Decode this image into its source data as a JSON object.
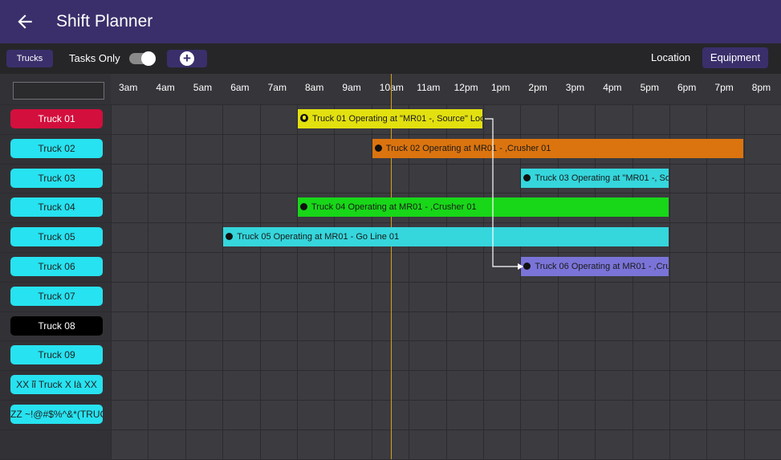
{
  "header": {
    "title": "Shift Planner",
    "back_icon": "arrow-left-icon",
    "bg": "#3a2f6b"
  },
  "toolbar": {
    "trucks_chip": "Trucks",
    "tasks_only_label": "Tasks Only",
    "tasks_only_on": false,
    "add_icon": "plus-circle-icon",
    "location_label": "Location",
    "equipment_label": "Equipment"
  },
  "search": {
    "value": "",
    "placeholder": ""
  },
  "timeline": {
    "hours": [
      "3am",
      "4am",
      "5am",
      "6am",
      "7am",
      "8am",
      "9am",
      "10am",
      "11am",
      "12pm",
      "1pm",
      "2pm",
      "3pm",
      "4pm",
      "5pm",
      "6pm",
      "7pm",
      "8pm"
    ],
    "now_marker_color": "#d4a017"
  },
  "rows": [
    {
      "label": "Truck 01",
      "color": "#d30f3d",
      "text_color": "#ffffff"
    },
    {
      "label": "Truck 02",
      "color": "#27e2f0",
      "text_color": "#222222"
    },
    {
      "label": "Truck 03",
      "color": "#27e2f0",
      "text_color": "#222222"
    },
    {
      "label": "Truck 04",
      "color": "#27e2f0",
      "text_color": "#222222"
    },
    {
      "label": "Truck 05",
      "color": "#27e2f0",
      "text_color": "#222222"
    },
    {
      "label": "Truck 06",
      "color": "#27e2f0",
      "text_color": "#222222"
    },
    {
      "label": "Truck 07",
      "color": "#27e2f0",
      "text_color": "#222222"
    },
    {
      "label": "Truck 08",
      "color": "#000000",
      "text_color": "#ffffff"
    },
    {
      "label": "Truck 09",
      "color": "#27e2f0",
      "text_color": "#222222"
    },
    {
      "label": "XX ỉỉ Truck X là XX",
      "color": "#27e2f0",
      "text_color": "#222222"
    },
    {
      "label": "ZZ ~!@#$%^&*(TRUCK",
      "color": "#27e2f0",
      "text_color": "#222222"
    }
  ],
  "tasks": [
    {
      "label": "Truck 01 Operating at \"MR01 -, Source\" Loc...",
      "color": "#e2e00f",
      "icon": "globe-icon"
    },
    {
      "label": "Truck 02 Operating at MR01 - ,Crusher 01",
      "color": "#db740f",
      "icon": "dot-icon"
    },
    {
      "label": "Truck 03 Operating at \"MR01 -, So...",
      "color": "#35d6dc",
      "icon": "dot-icon"
    },
    {
      "label": "Truck 04 Operating at MR01 - ,Crusher 01",
      "color": "#18d618",
      "icon": "dot-icon"
    },
    {
      "label": "Truck 05 Operating at MR01 - Go Line 01",
      "color": "#35d6dc",
      "icon": "dot-icon"
    },
    {
      "label": "Truck 06 Operating at MR01 - ,Cru...",
      "color": "#7a74d8",
      "icon": "dot-icon"
    }
  ]
}
